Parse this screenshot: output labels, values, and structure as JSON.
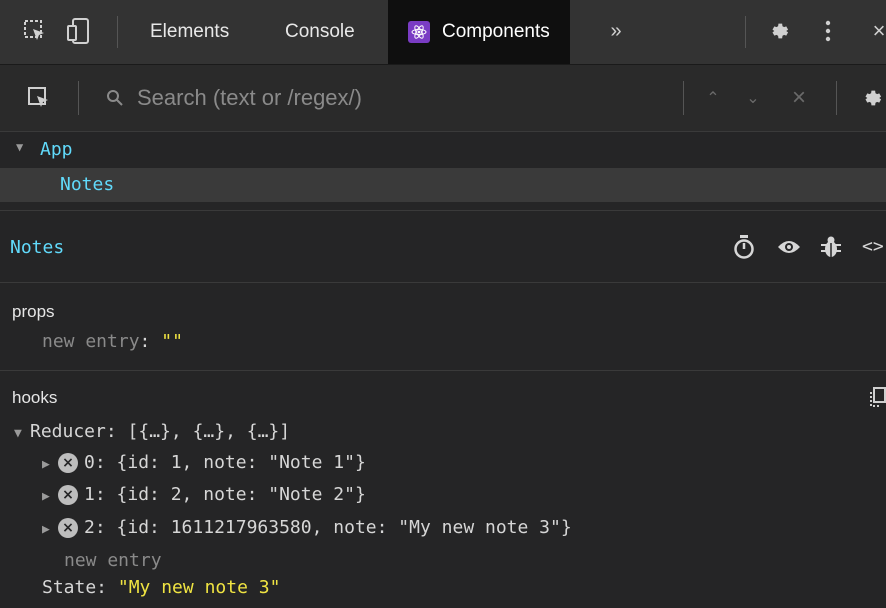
{
  "tabbar": {
    "tabs": [
      {
        "label": "Elements"
      },
      {
        "label": "Console"
      },
      {
        "label": "Components",
        "active": true
      }
    ],
    "more_icon": "chevron-double-right",
    "settings_icon": "gear",
    "kebab_icon": "vertical-dots",
    "close_icon": "close"
  },
  "search": {
    "placeholder": "Search (text or /regex/)"
  },
  "tree": {
    "root": "App",
    "child": "Notes"
  },
  "inspected": {
    "name": "Notes",
    "icons": [
      "stopwatch",
      "eye",
      "bug",
      "code"
    ]
  },
  "props": {
    "title": "props",
    "new_entry_key": "new entry",
    "new_entry_value": "\"\""
  },
  "hooks": {
    "title": "hooks",
    "reducer_label": "Reducer:",
    "reducer_summary": "[{…}, {…}, {…}]",
    "items": [
      {
        "index": "0:",
        "value": "{id: 1, note: \"Note 1\"}"
      },
      {
        "index": "1:",
        "value": "{id: 2, note: \"Note 2\"}"
      },
      {
        "index": "2:",
        "value": "{id: 1611217963580, note: \"My new note 3\"}"
      }
    ],
    "new_entry": "new entry",
    "state_label": "State:",
    "state_value": "\"My new note 3\""
  },
  "colors": {
    "accent_component": "#61dafb",
    "string_value": "#f0e442",
    "background": "#252526"
  }
}
